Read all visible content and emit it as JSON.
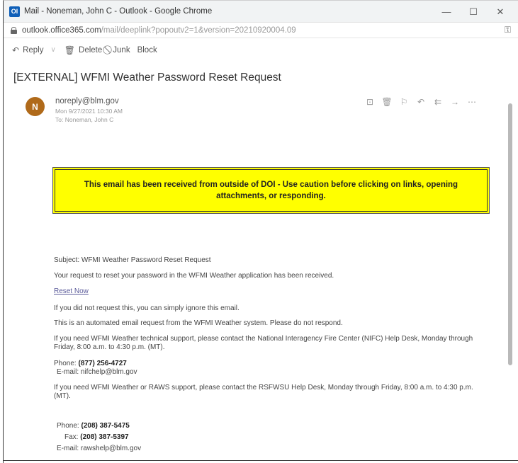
{
  "window": {
    "app_icon": "Ol",
    "title": "Mail - Noneman, John C - Outlook - Google Chrome",
    "minimize": "—",
    "maximize": "☐",
    "close": "✕"
  },
  "address": {
    "url_host": "outlook.office365.com",
    "url_path": "/mail/deeplink?popoutv2=1&version=20210920004.09",
    "right_icon": "key-icon"
  },
  "toolbar": {
    "reply": "Reply",
    "delete": "Delete",
    "junk": "Junk",
    "block": "Block"
  },
  "message": {
    "subject": "[EXTERNAL] WFMI Weather Password Reset Request",
    "avatar_initial": "N",
    "sender": "noreply@blm.gov",
    "date": "Mon 9/27/2021 10:30 AM",
    "to": "To: Noneman, John C"
  },
  "banner": {
    "text": "This email has been received from outside of DOI - Use caution before clicking on links, opening attachments, or responding."
  },
  "body": {
    "subject_line": "Subject: WFMI Weather Password Reset Request",
    "line1": "Your request to reset your password in the WFMI Weather application has been received.",
    "reset_link": "Reset Now",
    "line2": "If you did not request this, you can simply ignore this email.",
    "line3": "This is an automated email request from the WFMI Weather system. Please do not respond.",
    "line4": "If you need WFMI Weather technical support, please contact the National Interagency Fire Center (NIFC) Help Desk, Monday through Friday, 8:00 a.m. to 4:30 p.m. (MT).",
    "nifc_phone_label": "Phone:",
    "nifc_phone": "(877) 256-4727",
    "nifc_email": "E-mail: nifchelp@blm.gov",
    "line5": "If you need WFMI Weather or RAWS support, please contact the RSFWSU Help Desk, Monday through Friday, 8:00 a.m. to 4:30 p.m. (MT).",
    "raws_phone_label": "Phone:",
    "raws_phone": "(208) 387-5475",
    "raws_fax_label": "Fax:",
    "raws_fax": "(208) 387-5397",
    "raws_email": "E-mail: rawshelp@blm.gov"
  },
  "colors": {
    "banner_bg": "#ffff00",
    "avatar_bg": "#b06a1a",
    "link": "#5b5b9a"
  }
}
